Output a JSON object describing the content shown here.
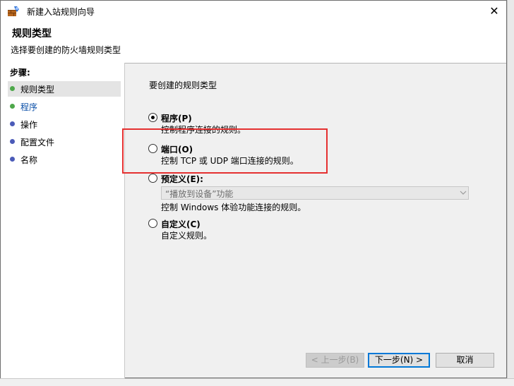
{
  "window": {
    "title": "新建入站规则向导"
  },
  "header": {
    "title": "规则类型",
    "subtitle": "选择要创建的防火墙规则类型"
  },
  "steps": {
    "title": "步骤:",
    "items": [
      {
        "label": "规则类型",
        "state": "current",
        "color": "#4ea84b"
      },
      {
        "label": "程序",
        "state": "active",
        "color": "#4ea84b"
      },
      {
        "label": "操作",
        "state": "pending",
        "color": "#4b5bb8"
      },
      {
        "label": "配置文件",
        "state": "pending",
        "color": "#4b5bb8"
      },
      {
        "label": "名称",
        "state": "pending",
        "color": "#4b5bb8"
      }
    ]
  },
  "content": {
    "title": "要创建的规则类型",
    "options": [
      {
        "label": "程序(P)",
        "description": "控制程序连接的规则。",
        "selected": true,
        "enabled": true
      },
      {
        "label": "端口(O)",
        "description": "控制 TCP 或 UDP 端口连接的规则。",
        "selected": false,
        "enabled": true
      },
      {
        "label": "预定义(E):",
        "description": "控制 Windows 体验功能连接的规则。",
        "selected": false,
        "enabled": false,
        "dropdown_value": "“播放到设备”功能"
      },
      {
        "label": "自定义(C)",
        "description": "自定义规则。",
        "selected": false,
        "enabled": true
      }
    ]
  },
  "buttons": {
    "back": "< 上一步(B)",
    "next": "下一步(N) >",
    "cancel": "取消"
  },
  "colors": {
    "highlight": "#e53030",
    "default_button_border": "#0078d7"
  }
}
